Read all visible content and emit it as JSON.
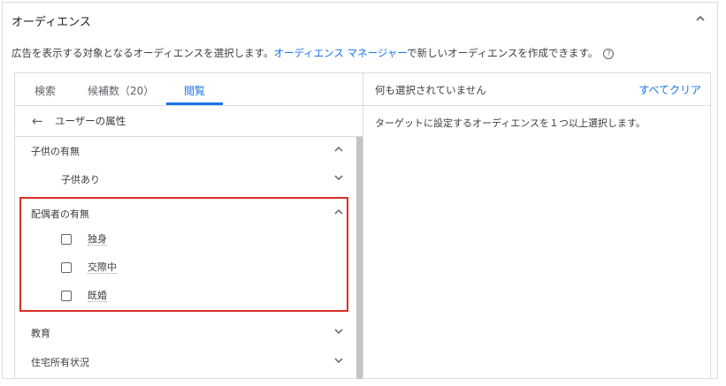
{
  "header": {
    "title": "オーディエンス"
  },
  "description": {
    "before": "広告を表示する対象となるオーディエンスを選択します。",
    "link": "オーディエンス マネージャー",
    "after": "で新しいオーディエンスを作成できます。"
  },
  "tabs": [
    {
      "label": "検索"
    },
    {
      "label": "候補数（20）"
    },
    {
      "label": "閲覧"
    }
  ],
  "back_label": "ユーザーの属性",
  "categories": {
    "children": {
      "label": "子供の有無",
      "sub": "子供あり"
    },
    "spouse": {
      "label": "配偶者の有無",
      "options": [
        "独身",
        "交際中",
        "既婚"
      ]
    },
    "education": {
      "label": "教育"
    },
    "home": {
      "label": "住宅所有状況"
    }
  },
  "right": {
    "status": "何も選択されていません",
    "clear_all": "すべてクリア",
    "message": "ターゲットに設定するオーディエンスを１つ以上選択します。"
  },
  "colors": {
    "accent": "#1a73e8",
    "highlight": "#d93025"
  }
}
